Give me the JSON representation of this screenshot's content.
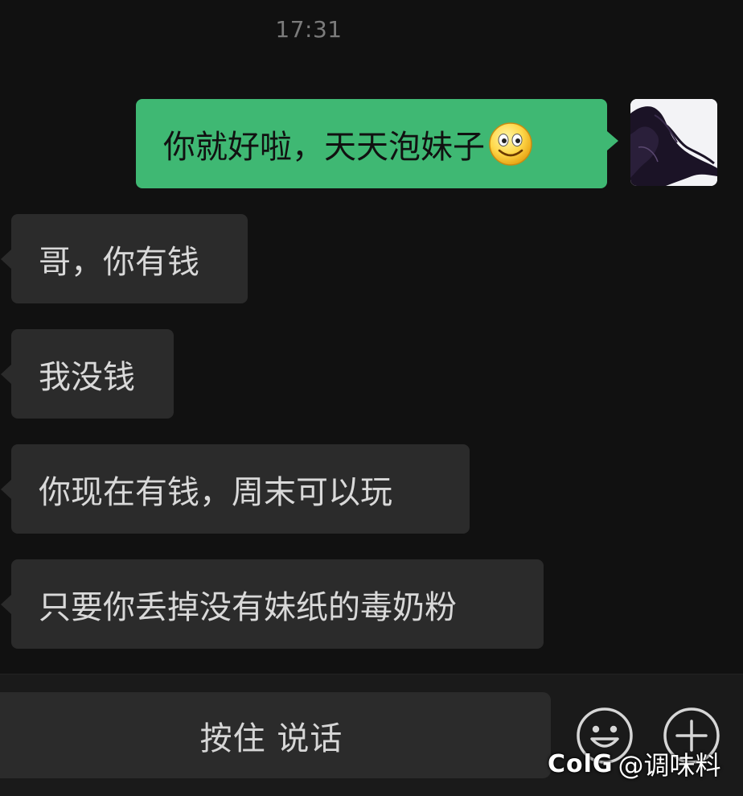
{
  "chat": {
    "timestamp": "17:31",
    "messages": [
      {
        "direction": "outgoing",
        "text": "你就好啦，天天泡妹子",
        "emoji": "smile-emoji"
      },
      {
        "direction": "incoming",
        "text": "哥，你有钱"
      },
      {
        "direction": "incoming",
        "text": "我没钱"
      },
      {
        "direction": "incoming",
        "text": "你现在有钱，周末可以玩"
      },
      {
        "direction": "incoming",
        "text": "只要你丢掉没有妹纸的毒奶粉"
      }
    ]
  },
  "input_bar": {
    "voice_button_label": "按住 说话",
    "emoji_button_icon": "emoji-face-icon",
    "more_button_icon": "plus-circle-icon"
  },
  "watermark": {
    "logo": "ColG",
    "handle": "@调味料"
  },
  "colors": {
    "background": "#111111",
    "outgoing_bubble": "#3fb873",
    "incoming_bubble": "#2b2b2b",
    "text_light": "#d9d9d9"
  }
}
